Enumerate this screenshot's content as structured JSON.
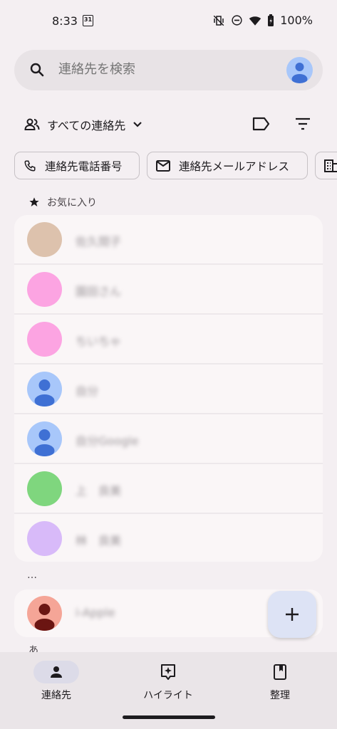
{
  "status": {
    "time": "8:33",
    "calendar_day": "31",
    "battery": "100%"
  },
  "search": {
    "placeholder": "連絡先を検索"
  },
  "filter": {
    "all_contacts_label": "すべての連絡先"
  },
  "chips": [
    {
      "label": "連絡先電話番号",
      "icon": "phone-icon"
    },
    {
      "label": "連絡先メールアドレス",
      "icon": "mail-icon"
    },
    {
      "label": "",
      "icon": "building-icon"
    }
  ],
  "sections": {
    "favorites_label": "お気に入り",
    "dots_label": "…",
    "next_label": "あ"
  },
  "favorites": [
    {
      "name": "佐久間子",
      "avatar_color": "#ddc2ad",
      "avatar_type": "photo"
    },
    {
      "name": "園田さん",
      "avatar_color": "#fca4e2",
      "avatar_type": "solid"
    },
    {
      "name": "ちいちゃ",
      "avatar_color": "#fca4e2",
      "avatar_type": "solid"
    },
    {
      "name": "自分",
      "avatar_color": "#a8c7fa",
      "avatar_type": "person"
    },
    {
      "name": "自分Google",
      "avatar_color": "#a8c7fa",
      "avatar_type": "person"
    },
    {
      "name": "上　良美",
      "avatar_color": "#7fd67e",
      "avatar_type": "solid"
    },
    {
      "name": "林　良美",
      "avatar_color": "#d8baf9",
      "avatar_type": "solid"
    }
  ],
  "others": [
    {
      "name": "i-Apple",
      "avatar_color": "#f5a597",
      "avatar_type": "person-dark"
    }
  ],
  "fab": {
    "icon": "plus-icon"
  },
  "nav": [
    {
      "label": "連絡先",
      "icon": "person-icon",
      "active": true
    },
    {
      "label": "ハイライト",
      "icon": "highlight-icon",
      "active": false
    },
    {
      "label": "整理",
      "icon": "bookmark-icon",
      "active": false
    }
  ],
  "colors": {
    "background": "#f4eff2",
    "card": "#faf6f7",
    "accent_person": "#3f70d4"
  }
}
